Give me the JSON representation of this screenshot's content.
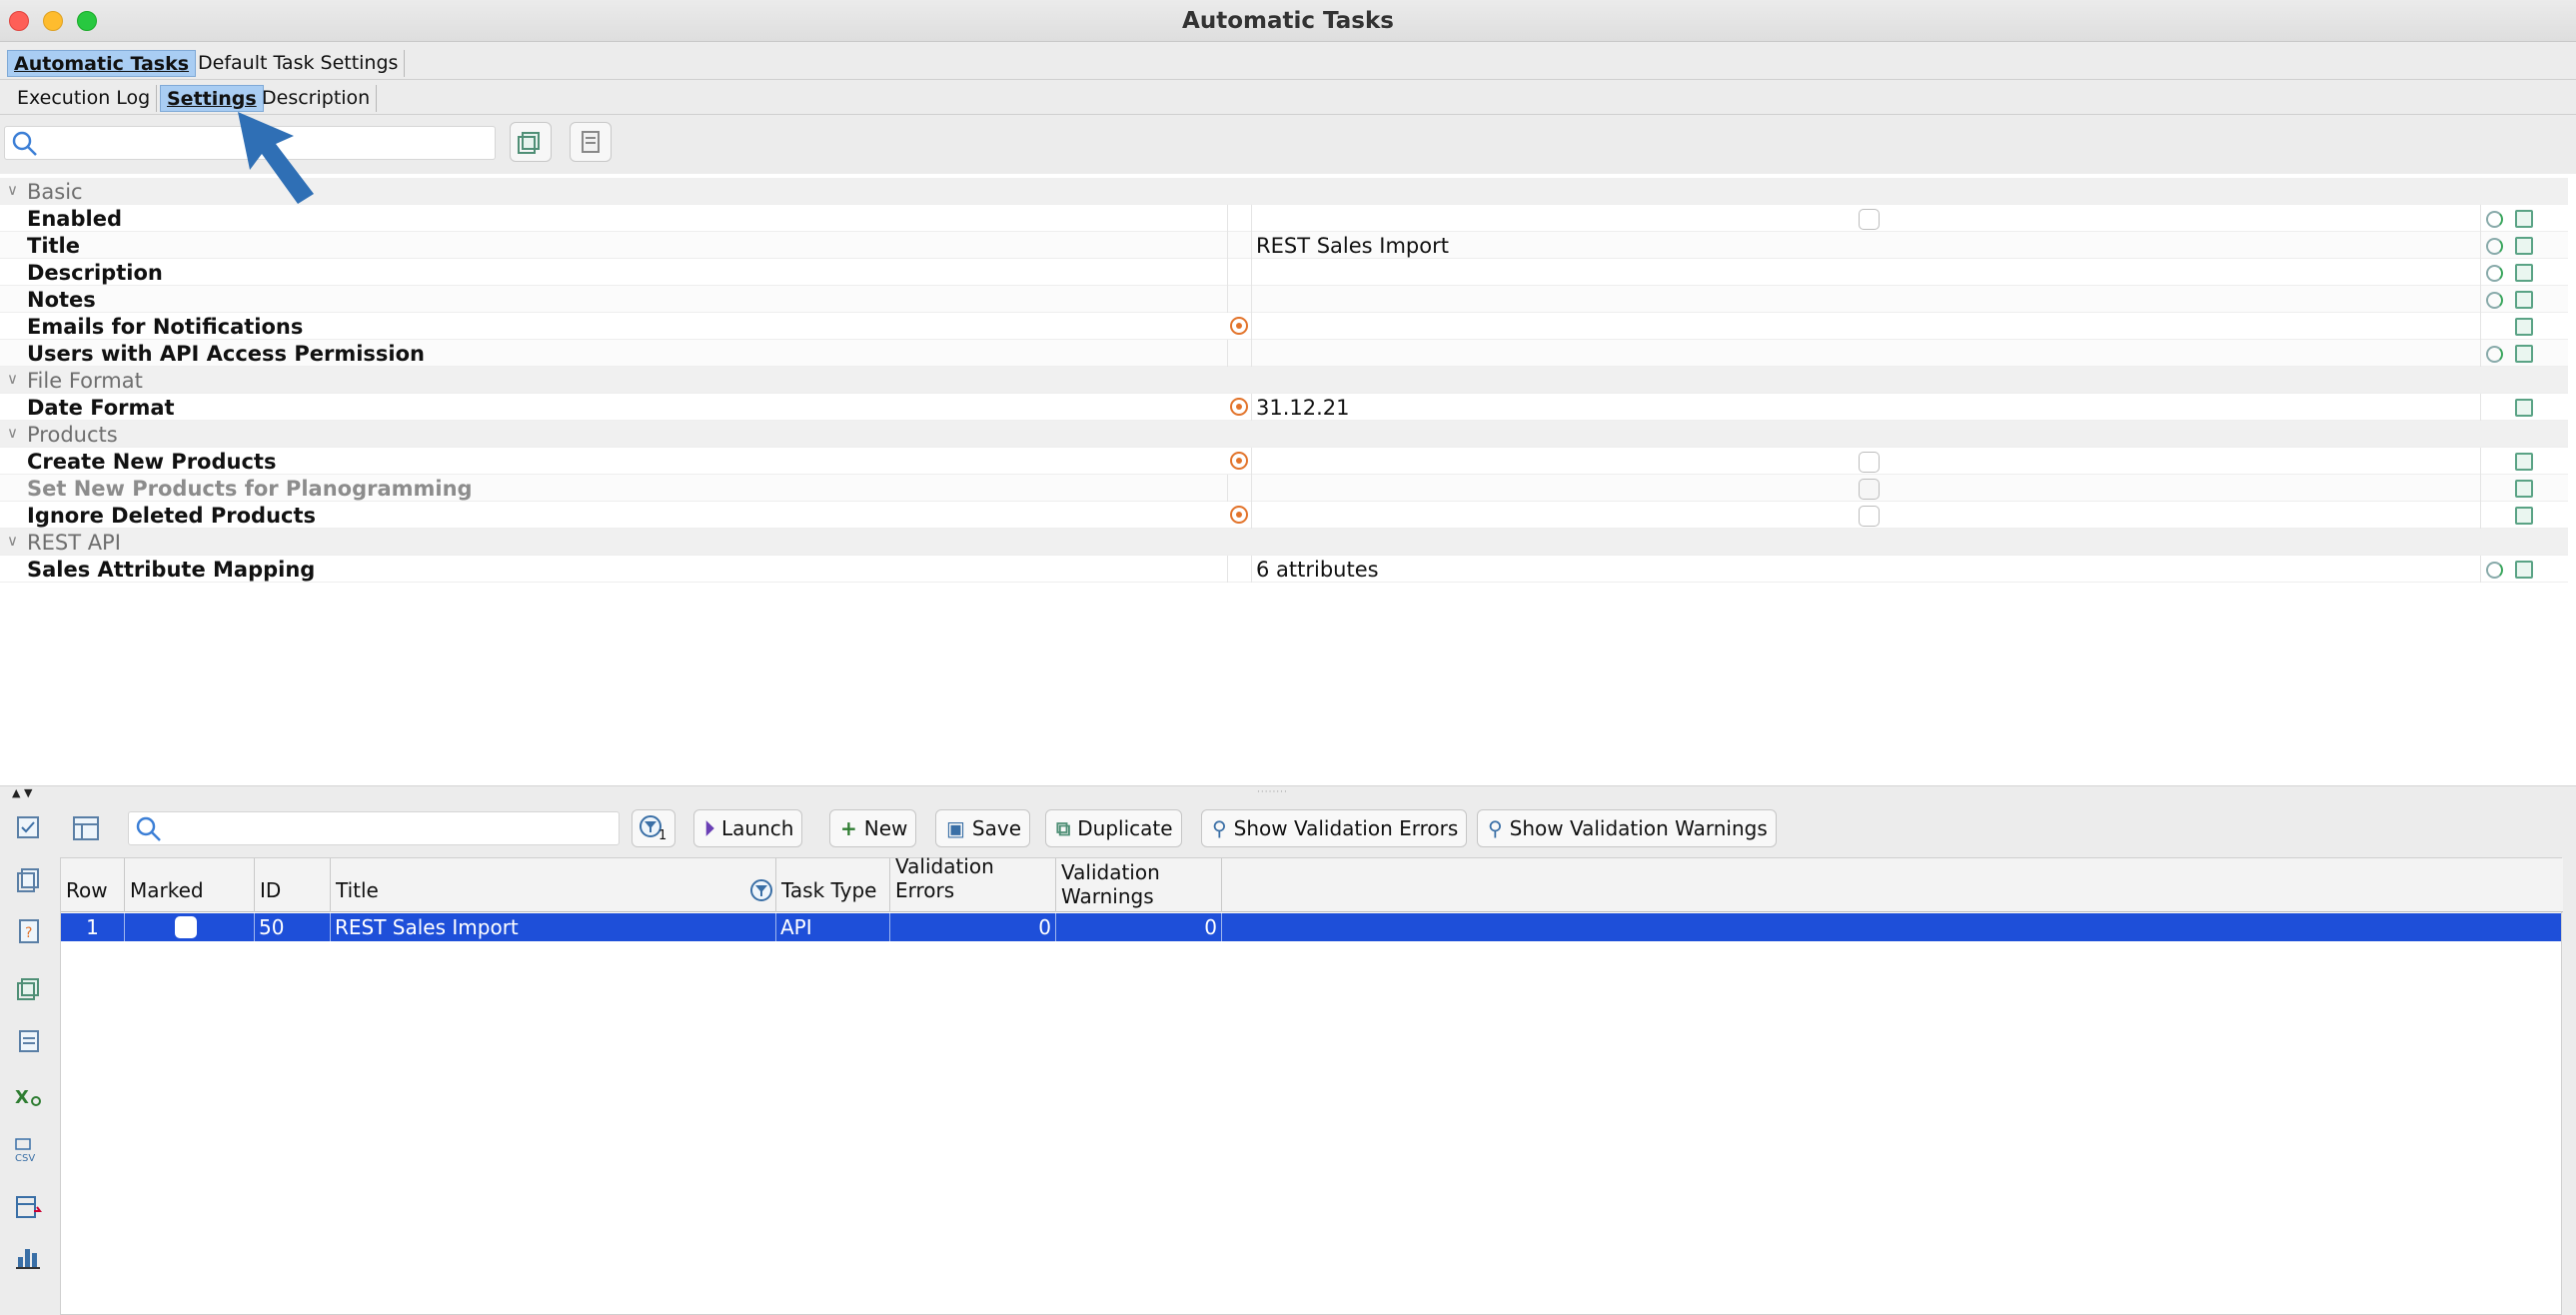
{
  "window": {
    "title": "Automatic Tasks"
  },
  "top_tabs": [
    {
      "label": "Automatic Tasks",
      "active": true
    },
    {
      "label": "Default Task Settings",
      "active": false
    }
  ],
  "sub_tabs": [
    {
      "label": "Execution Log",
      "active": false
    },
    {
      "label": "Settings",
      "active": true
    },
    {
      "label": "Description",
      "active": false
    }
  ],
  "settings": {
    "search_placeholder": "",
    "groups": [
      {
        "name": "Basic",
        "rows": [
          {
            "label": "Enabled",
            "type": "checkbox",
            "checked": false
          },
          {
            "label": "Title",
            "value": "REST Sales Import"
          },
          {
            "label": "Description",
            "value": ""
          },
          {
            "label": "Notes",
            "value": ""
          },
          {
            "label": "Emails for Notifications",
            "value": ""
          },
          {
            "label": "Users with API Access Permission",
            "value": ""
          }
        ]
      },
      {
        "name": "File Format",
        "rows": [
          {
            "label": "Date Format",
            "value": "31.12.21"
          }
        ]
      },
      {
        "name": "Products",
        "rows": [
          {
            "label": "Create New Products",
            "type": "checkbox",
            "checked": false
          },
          {
            "label": "Set New Products for Planogramming",
            "type": "checkbox",
            "checked": false,
            "disabled": true
          },
          {
            "label": "Ignore Deleted Products",
            "type": "checkbox",
            "checked": false
          }
        ]
      },
      {
        "name": "REST API",
        "rows": [
          {
            "label": "Sales Attribute Mapping",
            "value": "6 attributes"
          }
        ]
      }
    ]
  },
  "toolbar": {
    "search_placeholder": "",
    "filter_count": "1",
    "buttons": {
      "launch": "Launch",
      "new": "New",
      "save": "Save",
      "duplicate": "Duplicate",
      "show_errors": "Show Validation Errors",
      "show_warnings": "Show Validation Warnings"
    }
  },
  "table": {
    "columns": {
      "row": "Row",
      "marked": "Marked",
      "id": "ID",
      "title": "Title",
      "task_type": "Task Type",
      "validation_errors": "Validation Errors",
      "validation_warnings_1": "Validation",
      "validation_warnings_2": "Warnings"
    },
    "rows": [
      {
        "row": "1",
        "marked": false,
        "id": "50",
        "title": "REST Sales Import",
        "task_type": "API",
        "validation_errors": "0",
        "validation_warnings": "0"
      }
    ]
  },
  "colors": {
    "tab_active": "#a9cdf3",
    "selection": "#1e4fd9",
    "accent_arrow": "#2f6fb5",
    "required_icon": "#e2732a"
  }
}
